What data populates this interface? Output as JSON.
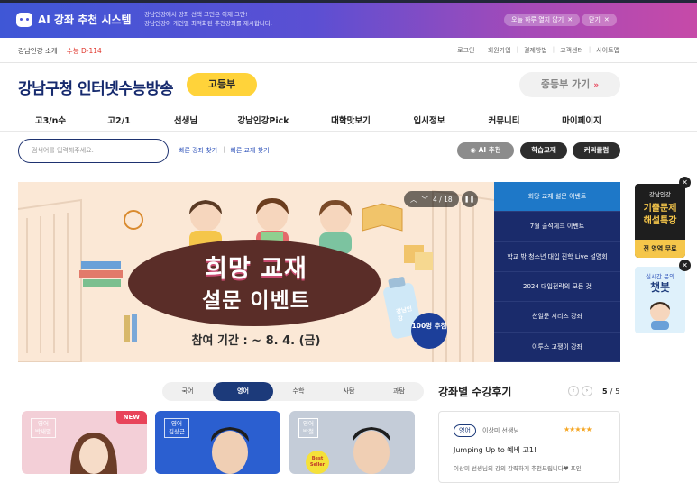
{
  "top_banner": {
    "logo_text": "AI 강좌 추천 시스템",
    "desc_line1": "강남인강에서 강좌 선택 고민은 이제 그만!",
    "desc_line2": "강남인강이 개인별 최적화된 추천강좌를 제시합니다.",
    "hide_today": "오늘 하루 열지 않기",
    "close": "닫기"
  },
  "util": {
    "left": [
      "강남인강 소개",
      "수능 D-114"
    ],
    "right": [
      "로그인",
      "회원가입",
      "결제방법",
      "고객센터",
      "사이트맵"
    ]
  },
  "header": {
    "logo": "강남구청 인터넷수능방송",
    "grade_badge": "고등부",
    "middle_school_btn": "중등부 가기"
  },
  "gnb": [
    "고3/n수",
    "고2/1",
    "선생님",
    "강남인강Pick",
    "대학맛보기",
    "입시정보",
    "커뮤니티",
    "마이페이지"
  ],
  "search": {
    "placeholder": "검색어를 입력해주세요.",
    "quick1": "빠른 강좌 찾기",
    "quick2": "빠른 교재 찾기",
    "btn_ai": "AI 추천",
    "btn_book": "학습교재",
    "btn_curri": "커리큘럼"
  },
  "hero": {
    "counter": "4 / 18",
    "title1": "희망 교재",
    "title2": "설문 이벤트",
    "date": "참여 기간 : ~ 8. 4. (금)",
    "badge": "100명 추첨",
    "pack_text": "강남인강"
  },
  "slide_list": [
    "희망 교재 설문 이벤트",
    "7월 출석체크 이벤트",
    "학교 밖 청소년 대입 진학 Live 설명회",
    "2024 대입전략의 모든 것",
    "천일문 시리즈 강좌",
    "이투스 고쟁이 강좌"
  ],
  "side_ads": {
    "ad1_brand": "강남인강",
    "ad1_title1": "기출문제",
    "ad1_title2": "해설특강",
    "ad1_sub": "전 영역 무료",
    "ad2_top": "실시간 문의",
    "ad2_title": "챗봇"
  },
  "subject_tabs": [
    "국어",
    "영어",
    "수학",
    "사탐",
    "과탐"
  ],
  "teacher_cards": [
    {
      "subject": "영어",
      "name": "박새별",
      "badge": "NEW"
    },
    {
      "subject": "영어",
      "name": "김상근"
    },
    {
      "subject": "영어",
      "name": "박철",
      "badge": "Best Seller"
    }
  ],
  "reviews": {
    "title": "강좌별 수강후기",
    "page": "5",
    "total": "5",
    "tag": "영어",
    "teacher": "이상미 선생님",
    "stars": "★★★★★",
    "review_title": "Jumping Up to 예비 고1!",
    "review_body": "이상미 선생님의 강의 강력하게 추천드립니다♥ 포인"
  },
  "colors": {
    "navy": "#1a2b6b",
    "accent_blue": "#1e78c8",
    "yellow": "#ffd33a",
    "red": "#e0352b"
  }
}
